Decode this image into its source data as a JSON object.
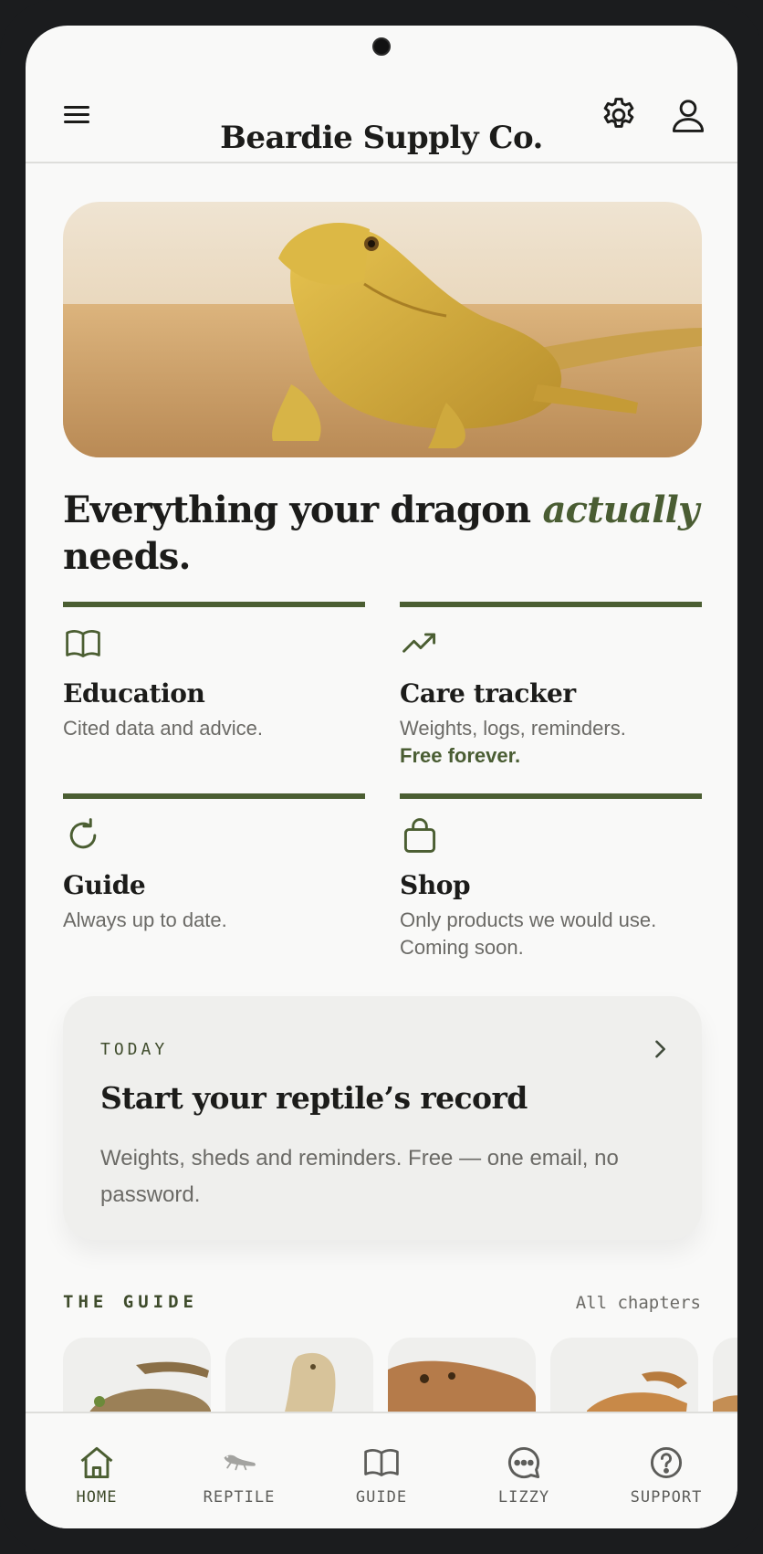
{
  "app": {
    "brand": "Beardie Supply Co."
  },
  "header": {
    "menu_icon": "menu-icon",
    "settings_icon": "gear-icon",
    "profile_icon": "user-icon"
  },
  "hero": {
    "image": "bearded-dragon-photo",
    "headline_main": "Everything your dragon ",
    "headline_emphasis": "actually",
    "headline_end": " needs."
  },
  "features": [
    {
      "icon": "book-icon",
      "title": "Education",
      "desc": "Cited data and advice.",
      "note": ""
    },
    {
      "icon": "trending-up-icon",
      "title": "Care tracker",
      "desc": "Weights, logs, reminders.",
      "note": "Free forever."
    },
    {
      "icon": "refresh-icon",
      "title": "Guide",
      "desc": "Always up to date.",
      "note": ""
    },
    {
      "icon": "bag-icon",
      "title": "Shop",
      "desc": "Only products we would use. Coming soon.",
      "note": ""
    }
  ],
  "today": {
    "label": "TODAY",
    "title": "Start your reptile’s record",
    "desc": "Weights, sheds and reminders. Free — one email, no password."
  },
  "guide": {
    "label": "THE GUIDE",
    "all_link": "All chapters",
    "thumbnails": [
      "lizard-thumbnail-1",
      "lizard-thumbnail-2",
      "lizard-thumbnail-3",
      "lizard-thumbnail-4",
      "lizard-thumbnail-5"
    ]
  },
  "nav": [
    {
      "icon": "home-icon",
      "label": "HOME",
      "active": true
    },
    {
      "icon": "lizard-icon",
      "label": "REPTILE",
      "active": false
    },
    {
      "icon": "book-icon",
      "label": "GUIDE",
      "active": false
    },
    {
      "icon": "chat-bubble-icon",
      "label": "LIZZY",
      "active": false
    },
    {
      "icon": "help-icon",
      "label": "SUPPORT",
      "active": false
    }
  ],
  "colors": {
    "accent": "#4b5e32",
    "text": "#1c1c1a",
    "muted": "#6b6a66",
    "background": "#f9f9f8",
    "card": "#efefed"
  }
}
